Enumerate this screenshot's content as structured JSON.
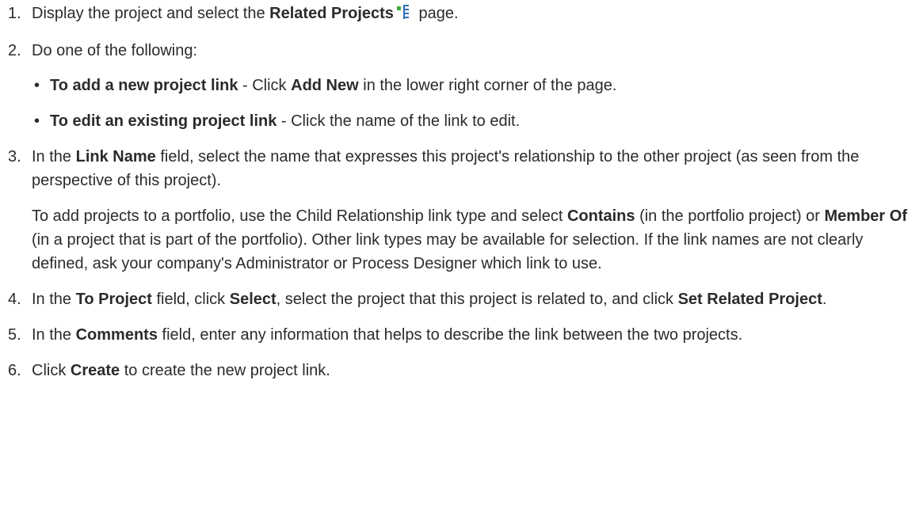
{
  "steps": [
    {
      "num": "1.",
      "p1": {
        "t1": "Display the project and select the ",
        "b1": "Related Projects",
        "icon": "related-projects-icon",
        "t2": " page."
      }
    },
    {
      "num": "2.",
      "p1": {
        "t1": "Do one of the following:"
      },
      "bullets": [
        {
          "dot": "•",
          "b1": "To add a new project link",
          "t1": " - Click ",
          "b2": "Add New",
          "t2": " in the lower right corner of the page."
        },
        {
          "dot": "•",
          "b1": "To edit an existing project link",
          "t1": " - Click the name of the link to edit."
        }
      ]
    },
    {
      "num": "3.",
      "p1": {
        "t1": "In the ",
        "b1": "Link Name",
        "t2": " field, select the name that expresses this project's relationship to the other project (as seen from the perspective of this project)."
      },
      "p2": {
        "t1": "To add projects to a portfolio, use the Child Relationship link type and select ",
        "b1": "Contains",
        "t2": " (in the portfolio project) or ",
        "b2": "Member Of",
        "t3": " (in a project that is part of the portfolio). Other link types may be available for selection. If the link names are not clearly defined, ask your company's Administrator or Process Designer which link to use."
      }
    },
    {
      "num": "4.",
      "p1": {
        "t1": "In the ",
        "b1": "To Project",
        "t2": " field, click ",
        "b2": "Select",
        "t3": ", select the project that this project is related to, and click ",
        "b3": "Set Related Project",
        "t4": "."
      }
    },
    {
      "num": "5.",
      "p1": {
        "t1": "In the ",
        "b1": "Comments",
        "t2": " field, enter any information that helps to describe the link between the two projects."
      }
    },
    {
      "num": "6.",
      "p1": {
        "t1": "Click ",
        "b1": "Create",
        "t2": " to create the new project link."
      }
    }
  ],
  "colors": {
    "text": "#2b2b2b",
    "icon_green": "#3aaa35",
    "icon_blue": "#2f6fb7"
  }
}
